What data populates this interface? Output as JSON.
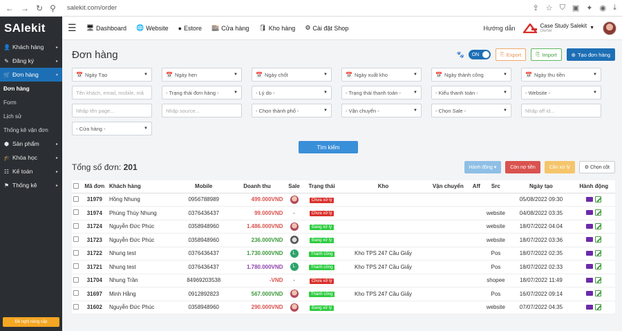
{
  "browser": {
    "back": "←",
    "forward": "→",
    "reload": "↻",
    "url": "salekit.com/order"
  },
  "app": {
    "logo": "SAlekit"
  },
  "sidebar": {
    "items": [
      {
        "label": "Khách hàng",
        "icon": "user-icon"
      },
      {
        "label": "Đăng ký",
        "icon": "register-icon"
      },
      {
        "label": "Đơn hàng",
        "icon": "cart-icon"
      },
      {
        "label": "Sản phẩm",
        "icon": "box-icon"
      },
      {
        "label": "Khóa học",
        "icon": "graduation-icon"
      },
      {
        "label": "Kế toán",
        "icon": "accounting-icon"
      },
      {
        "label": "Thống kê",
        "icon": "flag-icon"
      }
    ],
    "sub": [
      "Đơn hàng",
      "Form",
      "Lịch sử",
      "Thống kê vận đơn"
    ],
    "bottom_btn": "Đề nghị nâng cấp"
  },
  "topnav": {
    "items": [
      {
        "label": "Dashboard",
        "icon": "monitor-icon"
      },
      {
        "label": "Website",
        "icon": "globe-icon"
      },
      {
        "label": "Estore",
        "icon": "sphere-icon"
      },
      {
        "label": "Cửa hàng",
        "icon": "store-icon"
      },
      {
        "label": "Kho hàng",
        "icon": "database-icon"
      },
      {
        "label": "Cài đặt Shop",
        "icon": "gear-icon"
      }
    ],
    "guide": "Hướng dẫn",
    "company": "Case Study Salekit",
    "role": "Owner"
  },
  "page": {
    "title": "Đơn hàng",
    "toggle": "ON",
    "export": "Export",
    "import": "Import",
    "create": "Tạo đơn hàng"
  },
  "filters": {
    "row1": [
      "Ngày Tạo",
      "Ngày hẹn",
      "Ngày chốt",
      "Ngày xuất kho",
      "Ngày thành công",
      "Ngày thu tiền"
    ],
    "row2": [
      {
        "text": "Tên khách, email, mobile, mã",
        "placeholder": true
      },
      {
        "text": "- Trạng thái đơn hàng -",
        "placeholder": false
      },
      {
        "text": "- Lý do -",
        "placeholder": false
      },
      {
        "text": "- Trạng thái thanh toán -",
        "placeholder": false
      },
      {
        "text": "- Kiểu thanh toán -",
        "placeholder": false
      },
      {
        "text": "- Website -",
        "placeholder": false
      }
    ],
    "row3": [
      {
        "text": "Nhập tên page...",
        "placeholder": true
      },
      {
        "text": "Nhập source...",
        "placeholder": true
      },
      {
        "text": "- Chọn thành phố -",
        "placeholder": false
      },
      {
        "text": "- Vận chuyển -",
        "placeholder": false
      },
      {
        "text": "- Chọn Sale -",
        "placeholder": false
      },
      {
        "text": "Nhập aff id...",
        "placeholder": true
      }
    ],
    "row4": "- Cửa hàng -",
    "search": "Tìm kiếm"
  },
  "summary": {
    "label": "Tổng số đơn:",
    "count": "201"
  },
  "actions": {
    "action": "Hành động",
    "debt": "Còn nợ tiền",
    "todo": "Cần xử lý",
    "columns": "Chọn cột"
  },
  "table": {
    "headers": [
      "Mã đơn",
      "Khách hàng",
      "Mobile",
      "Doanh thu",
      "Sale",
      "Trạng thái",
      "Kho",
      "Vận chuyển",
      "Aff",
      "Src",
      "Ngày tạo",
      "Hành động"
    ],
    "rows": [
      {
        "id": "31979",
        "customer": "Hồng Nhung",
        "mobile": "0956788989",
        "revenue": "499.000VND",
        "revenue_color": "#d9534f",
        "sale": "avatar",
        "status": "Chưa xử lý",
        "status_color": "#d9302c",
        "warehouse": "",
        "src": "",
        "date": "05/08/2022 09:30"
      },
      {
        "id": "31974",
        "customer": "Phùng Thúy Nhung",
        "mobile": "0376436437",
        "revenue": "99.000VND",
        "revenue_color": "#d9534f",
        "sale": "-",
        "status": "Chưa xử lý",
        "status_color": "#d9302c",
        "warehouse": "",
        "src": "website",
        "date": "04/08/2022 03:35"
      },
      {
        "id": "31724",
        "customer": "Nguyễn Đức Phúc",
        "mobile": "0358948960",
        "revenue": "1.486.000VND",
        "revenue_color": "#d9534f",
        "sale": "avatar",
        "status": "Đang xử lý",
        "status_color": "#2ecc40",
        "warehouse": "",
        "src": "website",
        "date": "18/07/2022 04:04"
      },
      {
        "id": "31723",
        "customer": "Nguyễn Đức Phúc",
        "mobile": "0358948960",
        "revenue": "236.000VND",
        "revenue_color": "#3e9a3e",
        "sale": "avatar-bw",
        "status": "Đang xử lý",
        "status_color": "#2ecc40",
        "warehouse": "",
        "src": "website",
        "date": "18/07/2022 03:36"
      },
      {
        "id": "31722",
        "customer": "Nhung test",
        "mobile": "0376436437",
        "revenue": "1.730.000VND",
        "revenue_color": "#3e9a3e",
        "sale": "L",
        "status": "Thành công",
        "status_color": "#2ecc40",
        "warehouse": "Kho TPS 247 Cầu Giấy",
        "src": "Pos",
        "date": "18/07/2022 02:35"
      },
      {
        "id": "31721",
        "customer": "Nhung test",
        "mobile": "0376436437",
        "revenue": "1.780.000VND",
        "revenue_color": "#8e44ad",
        "sale": "L",
        "status": "Thành công",
        "status_color": "#2ecc40",
        "warehouse": "Kho TPS 247 Cầu Giấy",
        "src": "Pos",
        "date": "18/07/2022 02:33"
      },
      {
        "id": "31704",
        "customer": "Nhung Trần",
        "mobile": "84969203538",
        "revenue": "-VND",
        "revenue_color": "#d9534f",
        "sale": "-",
        "status": "Chưa xử lý",
        "status_color": "#d9302c",
        "warehouse": "",
        "src": "shopee",
        "date": "18/07/2022 11:49"
      },
      {
        "id": "31697",
        "customer": "Minh Hằng",
        "mobile": "0912892823",
        "revenue": "567.000VND",
        "revenue_color": "#3e9a3e",
        "sale": "avatar",
        "status": "Thành công",
        "status_color": "#2ecc40",
        "warehouse": "Kho TPS 247 Cầu Giấy",
        "src": "Pos",
        "date": "16/07/2022 09:14"
      },
      {
        "id": "31602",
        "customer": "Nguyễn Đức Phúc",
        "mobile": "0358948960",
        "revenue": "290.000VND",
        "revenue_color": "#d9534f",
        "sale": "avatar",
        "status": "Đang xử lý",
        "status_color": "#2ecc40",
        "warehouse": "",
        "src": "website",
        "date": "07/07/2022 04:35"
      }
    ]
  }
}
